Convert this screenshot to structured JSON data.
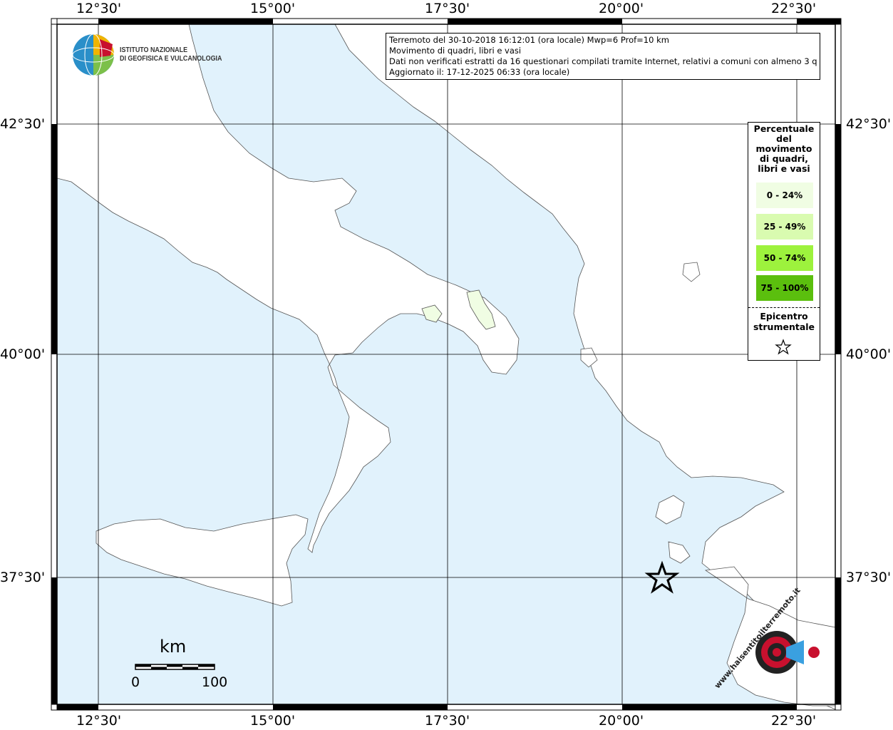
{
  "info": {
    "line1": "Terremoto del 30-10-2018 16:12:01 (ora locale) Mwp=6 Prof=10 km",
    "line2": "Movimento di quadri, libri e vasi",
    "line3": "Dati non verificati estratti da 16 questionari compilati tramite Internet, relativi a comuni con almeno 3 questionari.",
    "line4": "Aggiornato il: 17-12-2025 06:33 (ora locale)"
  },
  "logo": {
    "line1": "ISTITUTO NAZIONALE",
    "line2": "DI GEOFISICA E VULCANOLOGIA"
  },
  "axes": {
    "lon_labels": [
      "12°30'",
      "15°00'",
      "17°30'",
      "20°00'",
      "22°30'"
    ],
    "lat_labels": [
      "42°30'",
      "40°00'",
      "37°30'"
    ]
  },
  "legend": {
    "title": "Percentuale\ndel\nmovimento\ndi quadri,\nlibri e vasi",
    "items": [
      {
        "label": "0 - 24%",
        "color": "#f0fde3"
      },
      {
        "label": "25 - 49%",
        "color": "#d9fbb0"
      },
      {
        "label": "50 - 74%",
        "color": "#9df23d"
      },
      {
        "label": "75 - 100%",
        "color": "#5bbf0e"
      }
    ],
    "epicenter": "Epicentro\nstrumentale"
  },
  "scale": {
    "unit": "km",
    "min": "0",
    "max": "100"
  },
  "watermark": {
    "text": "www.haisentitoilterremoto.it"
  },
  "colors": {
    "sea": "#e1f2fc",
    "land": "#ffffff",
    "grid": "#000000"
  }
}
